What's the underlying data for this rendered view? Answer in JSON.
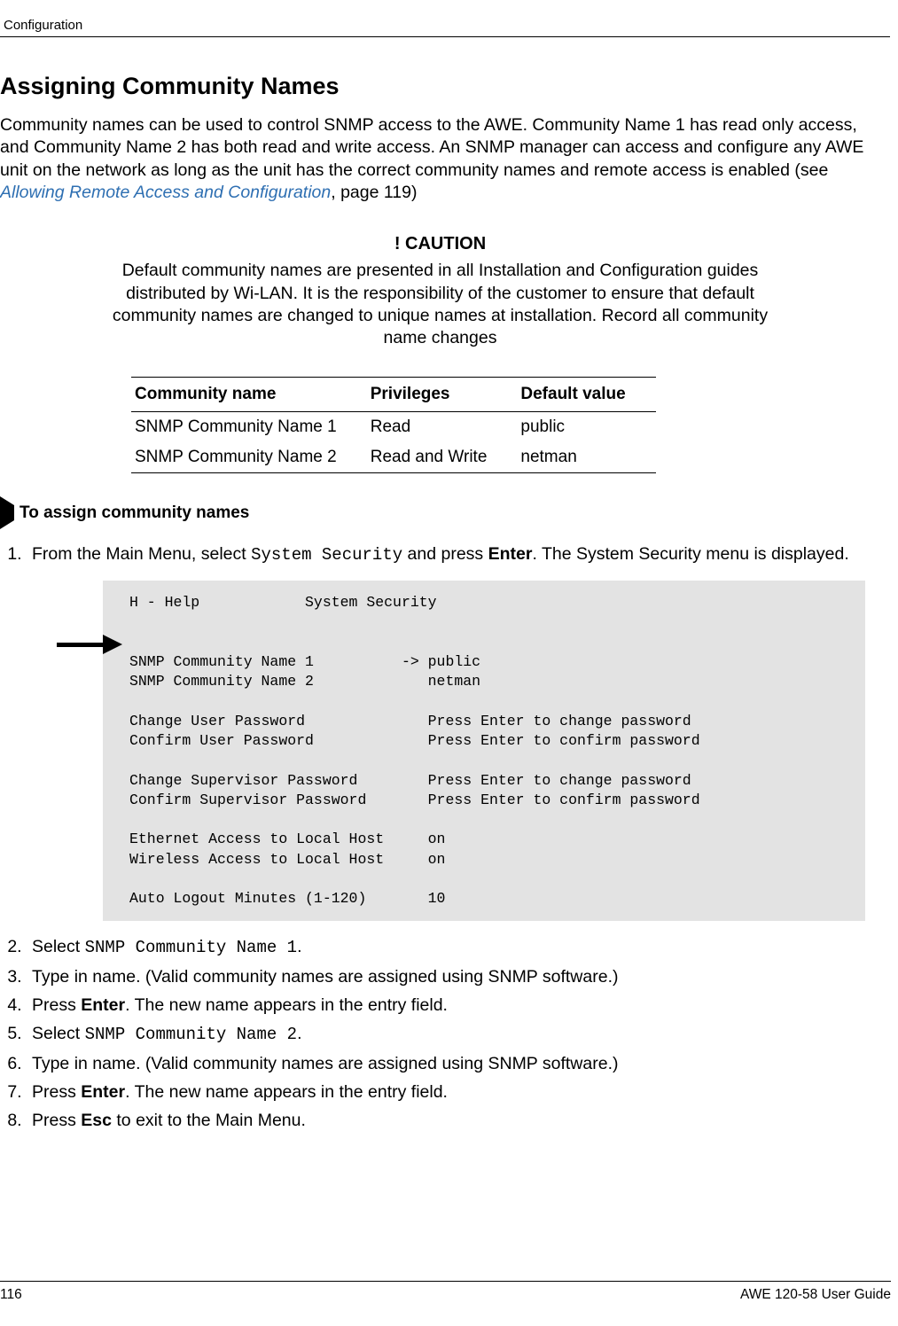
{
  "header": {
    "section": "Configuration"
  },
  "title": "Assigning Community Names",
  "intro": {
    "prefix": "Community names can be used to control SNMP access to the AWE. Community Name 1 has read only access, and Community Name 2 has both read and write access. An SNMP manager can access and configure any AWE unit on the network as long as the unit has the correct community names and remote access is enabled (see ",
    "link": "Allowing Remote Access and Configuration",
    "suffix": ", page 119)"
  },
  "caution": {
    "title": "! CAUTION",
    "text": "Default community names are presented in all Installation and Configuration guides distributed by Wi-LAN. It is the responsibility of the customer to ensure that default community names are changed to unique names at installation. Record all community name changes"
  },
  "table": {
    "headers": {
      "c0": "Community name",
      "c1": "Privileges",
      "c2": "Default value"
    },
    "rows": [
      {
        "c0": "SNMP Community Name 1",
        "c1": "Read",
        "c2": "public"
      },
      {
        "c0": "SNMP Community Name 2",
        "c1": "Read and Write",
        "c2": "netman"
      }
    ]
  },
  "proc_heading": "To assign community names",
  "steps": {
    "s1": {
      "a": "From the Main Menu, select ",
      "code": "System Security",
      "b": " and press ",
      "bold": "Enter",
      "c": ". The System Security menu is displayed."
    },
    "s2": {
      "a": "Select ",
      "code": "SNMP Community Name 1",
      "b": "."
    },
    "s3": {
      "a": "Type in name. (Valid community names are assigned using SNMP software.)"
    },
    "s4": {
      "a": "Press ",
      "bold": "Enter",
      "b": ". The new name appears in the entry field."
    },
    "s5": {
      "a": "Select ",
      "code": "SNMP Community Name 2",
      "b": "."
    },
    "s6": {
      "a": "Type in name. (Valid community names are assigned using SNMP software.)"
    },
    "s7": {
      "a": "Press ",
      "bold": "Enter",
      "b": ". The new name appears in the entry field."
    },
    "s8": {
      "a": "Press ",
      "bold": "Esc",
      "b": " to exit to the Main Menu."
    }
  },
  "terminal": "H - Help            System Security\n\n\nSNMP Community Name 1          -> public\nSNMP Community Name 2             netman\n\nChange User Password              Press Enter to change password\nConfirm User Password             Press Enter to confirm password\n\nChange Supervisor Password        Press Enter to change password\nConfirm Supervisor Password       Press Enter to confirm password\n\nEthernet Access to Local Host     on\nWireless Access to Local Host     on\n\nAuto Logout Minutes (1-120)       10",
  "footer": {
    "page": "116",
    "doc": "AWE 120-58 User Guide"
  }
}
